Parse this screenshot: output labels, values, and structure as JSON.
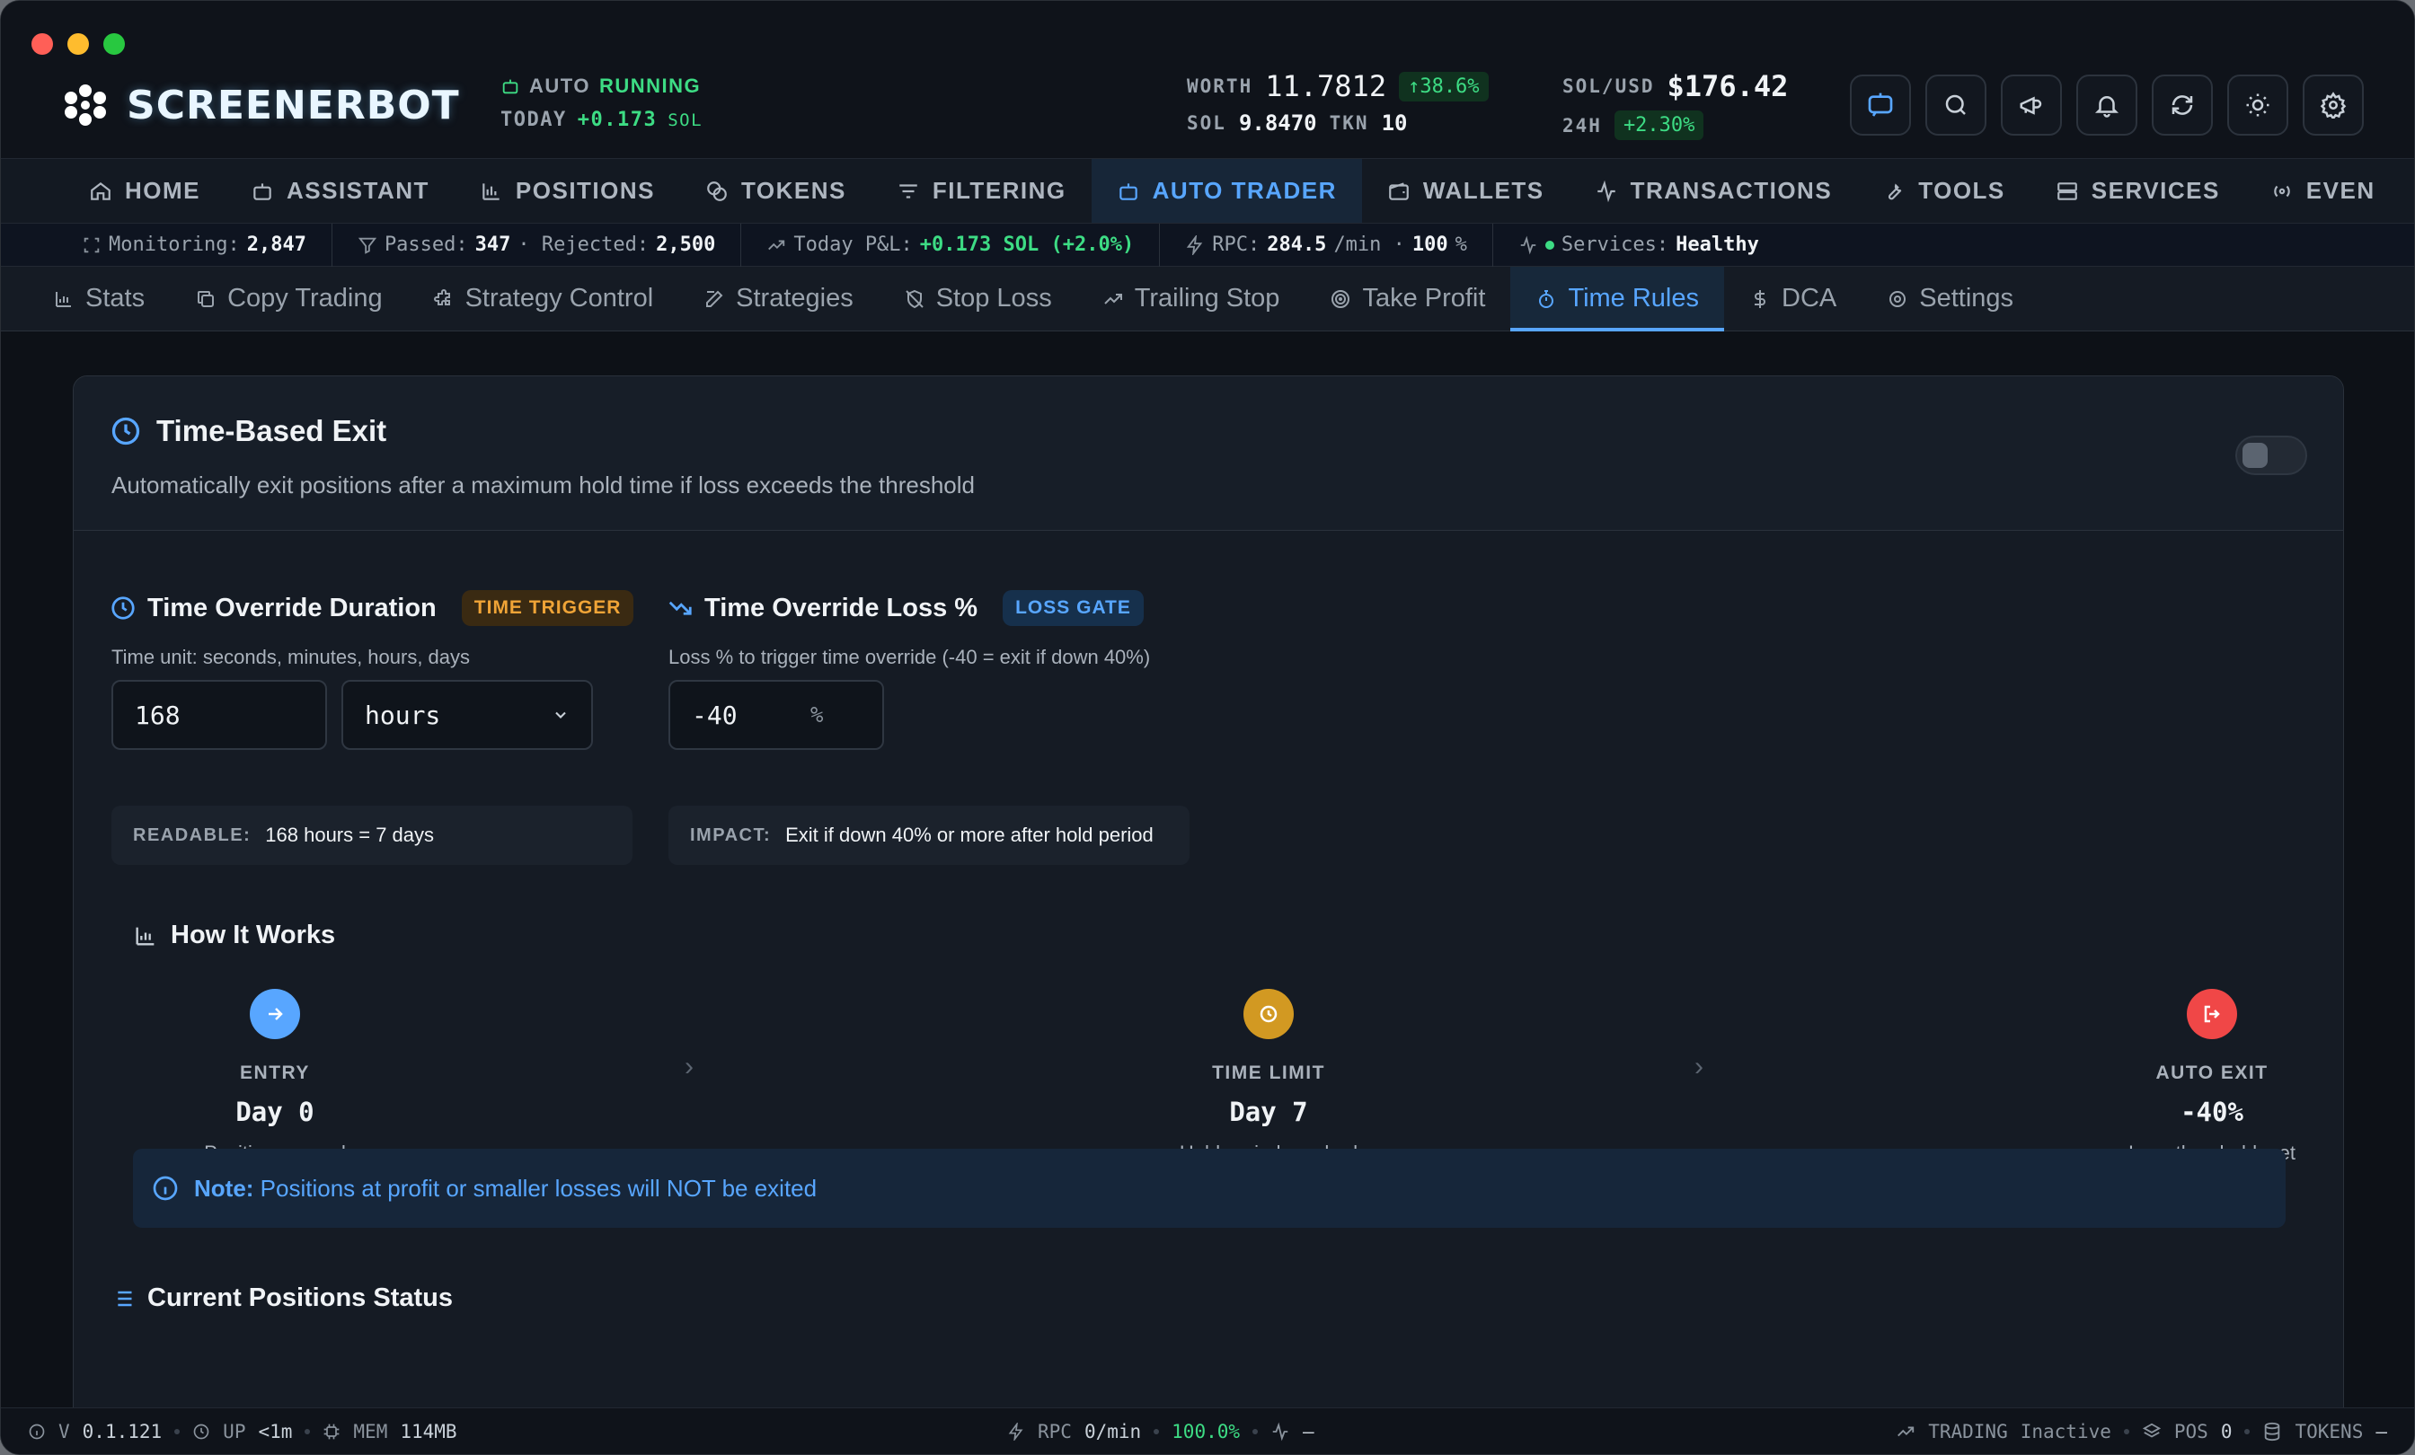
{
  "app": {
    "name": "SCREENERBOT"
  },
  "header": {
    "auto_label": "AUTO",
    "auto_state": "RUNNING",
    "today_label": "TODAY",
    "today_value": "+0.173",
    "today_unit": "SOL",
    "worth_label": "WORTH",
    "worth_value": "11.7812",
    "worth_change": "↑38.6%",
    "sol_label": "SOL",
    "sol_value": "9.8470",
    "tkn_label": "TKN",
    "tkn_value": "10",
    "solusd_label": "SOL/USD",
    "solusd_value": "$176.42",
    "h24_label": "24H",
    "h24_value": "+2.30%"
  },
  "nav": [
    {
      "label": "HOME",
      "icon": "home-icon"
    },
    {
      "label": "ASSISTANT",
      "icon": "robot-icon"
    },
    {
      "label": "POSITIONS",
      "icon": "bar-chart-icon"
    },
    {
      "label": "TOKENS",
      "icon": "coins-icon"
    },
    {
      "label": "FILTERING",
      "icon": "filter-icon"
    },
    {
      "label": "AUTO TRADER",
      "icon": "bot-icon",
      "active": true
    },
    {
      "label": "WALLETS",
      "icon": "wallet-icon"
    },
    {
      "label": "TRANSACTIONS",
      "icon": "activity-icon"
    },
    {
      "label": "TOOLS",
      "icon": "wrench-icon"
    },
    {
      "label": "SERVICES",
      "icon": "server-icon"
    },
    {
      "label": "EVEN",
      "icon": "radio-icon"
    }
  ],
  "statusbar": {
    "monitoring_label": "Monitoring:",
    "monitoring_value": "2,847",
    "passed_label": "Passed:",
    "passed_value": "347",
    "rejected_label": "· Rejected:",
    "rejected_value": "2,500",
    "pnl_label": "Today P&L:",
    "pnl_value": "+0.173 SOL (+2.0%)",
    "rpc_label": "RPC:",
    "rpc_value": "284.5",
    "rpc_unit": "/min ·",
    "rpc_pct": "100",
    "rpc_pct_unit": "%",
    "services_label": "Services:",
    "services_value": "Healthy"
  },
  "subtabs": [
    {
      "label": "Stats"
    },
    {
      "label": "Copy Trading"
    },
    {
      "label": "Strategy Control"
    },
    {
      "label": "Strategies"
    },
    {
      "label": "Stop Loss"
    },
    {
      "label": "Trailing Stop"
    },
    {
      "label": "Take Profit"
    },
    {
      "label": "Time Rules",
      "active": true
    },
    {
      "label": "DCA"
    },
    {
      "label": "Settings"
    }
  ],
  "card": {
    "title": "Time-Based Exit",
    "subtitle": "Automatically exit positions after a maximum hold time if loss exceeds the threshold",
    "duration": {
      "title": "Time Override Duration",
      "badge": "TIME TRIGGER",
      "help": "Time unit: seconds, minutes, hours, days",
      "value": "168",
      "unit": "hours",
      "readable_label": "READABLE:",
      "readable_value": "168 hours = 7 days"
    },
    "loss": {
      "title": "Time Override Loss %",
      "badge": "LOSS GATE",
      "help": "Loss % to trigger time override (-40 = exit if down 40%)",
      "value": "-40",
      "unit": "%",
      "impact_label": "IMPACT:",
      "impact_value": "Exit if down 40% or more after hold period"
    },
    "how": {
      "title": "How It Works",
      "steps": [
        {
          "label": "ENTRY",
          "value": "Day 0",
          "desc": "Position opened",
          "color": "#58a6ff"
        },
        {
          "label": "TIME LIMIT",
          "value": "Day 7",
          "desc": "Hold period reached",
          "color": "#d29922"
        },
        {
          "label": "AUTO EXIT",
          "value": "-40%",
          "desc": "Loss threshold met",
          "color": "#f04747"
        }
      ]
    },
    "note_label": "Note:",
    "note_text": "Positions at profit or smaller losses will NOT be exited",
    "positions_title": "Current Positions Status"
  },
  "footer": {
    "version_label": "V",
    "version": "0.1.121",
    "up_label": "UP",
    "up_value": "<1m",
    "mem_label": "MEM",
    "mem_value": "114MB",
    "rpc_label": "RPC",
    "rpc_value": "0/min",
    "rpc_pct": "100.0%",
    "activity_value": "–",
    "trading_label": "TRADING",
    "trading_value": "Inactive",
    "pos_label": "POS",
    "pos_value": "0",
    "tokens_label": "TOKENS",
    "tokens_value": "–"
  },
  "colors": {
    "accent": "#58a6ff",
    "green": "#3ddc84",
    "orange": "#f0a437",
    "red": "#f04747"
  }
}
